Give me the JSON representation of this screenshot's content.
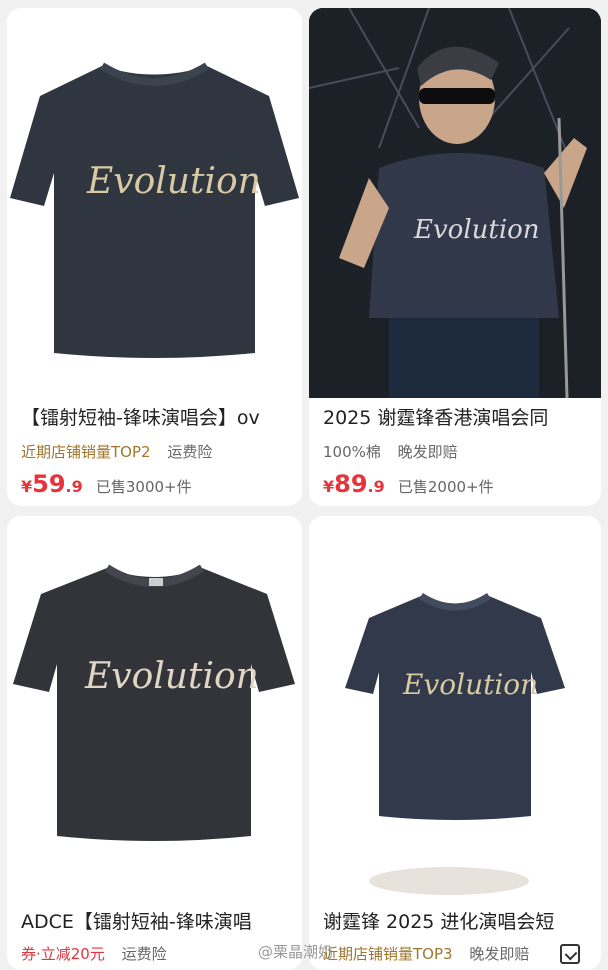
{
  "products": [
    {
      "title": "【镭射短袖-锋味演唱会】ov",
      "tags": [
        "近期店铺销量TOP2",
        "运费险"
      ],
      "price_currency": "¥",
      "price_int": "59",
      "price_dec": ".9",
      "sold": "已售3000+件",
      "image_icon": "t-shirt-evolution",
      "shirt_text": "Evolution"
    },
    {
      "title": "2025 谢霆锋香港演唱会同",
      "tags": [
        "100%棉",
        "晚发即赔"
      ],
      "price_currency": "¥",
      "price_int": "89",
      "price_dec": ".9",
      "sold": "已售2000+件",
      "image_icon": "singer-on-stage",
      "shirt_text": "Evolution"
    },
    {
      "title": "ADCE【镭射短袖-锋味演唱",
      "tags": [
        "券·立减20元",
        "运费险"
      ],
      "image_icon": "t-shirt-evolution",
      "shirt_text": "Evolution"
    },
    {
      "title": "谢霆锋 2025 进化演唱会短",
      "tags": [
        "近期店铺销量TOP3",
        "晚发即赔"
      ],
      "image_icon": "t-shirt-evolution",
      "shirt_text": "Evolution"
    }
  ],
  "watermark": "@栗晶潮奶",
  "colors": {
    "price": "#e8333a",
    "rank": "#a0752d",
    "card": "#ffffff",
    "bg": "#f1f1f1"
  }
}
